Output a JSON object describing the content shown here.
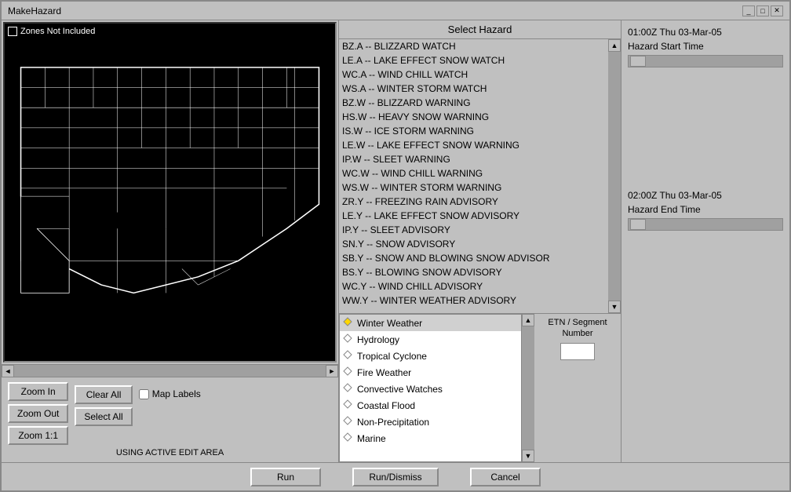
{
  "window": {
    "title": "MakeHazard",
    "controls": [
      "_",
      "□",
      "✕"
    ]
  },
  "map": {
    "zones_label": "Zones Not Included",
    "status": "USING ACTIVE EDIT AREA"
  },
  "buttons": {
    "zoom_in": "Zoom In",
    "zoom_out": "Zoom Out",
    "zoom_1_1": "Zoom 1:1",
    "clear_all": "Clear All",
    "select_all": "Select All",
    "map_labels": "Map Labels",
    "run": "Run",
    "run_dismiss": "Run/Dismiss",
    "cancel": "Cancel"
  },
  "hazard_panel": {
    "title": "Select Hazard",
    "items": [
      "BZ.A -- BLIZZARD WATCH",
      "LE.A -- LAKE EFFECT SNOW WATCH",
      "WC.A -- WIND CHILL WATCH",
      "WS.A -- WINTER STORM WATCH",
      "BZ.W -- BLIZZARD WARNING",
      "HS.W -- HEAVY SNOW WARNING",
      "IS.W -- ICE STORM WARNING",
      "LE.W -- LAKE EFFECT SNOW WARNING",
      "IP.W -- SLEET WARNING",
      "WC.W -- WIND CHILL WARNING",
      "WS.W -- WINTER STORM WARNING",
      "ZR.Y -- FREEZING RAIN ADVISORY",
      "LE.Y -- LAKE EFFECT SNOW ADVISORY",
      "IP.Y -- SLEET ADVISORY",
      "SN.Y -- SNOW ADVISORY",
      "SB.Y -- SNOW AND BLOWING SNOW ADVISOR",
      "BS.Y -- BLOWING SNOW ADVISORY",
      "WC.Y -- WIND CHILL ADVISORY",
      "WW.Y -- WINTER WEATHER ADVISORY"
    ]
  },
  "categories": {
    "items": [
      "Winter Weather",
      "Hydrology",
      "Tropical Cyclone",
      "Fire Weather",
      "Convective Watches",
      "Coastal Flood",
      "Non-Precipitation",
      "Marine"
    ],
    "selected": "Winter Weather"
  },
  "etn": {
    "label": "ETN / Segment Number",
    "value": ""
  },
  "time": {
    "start_value": "01:00Z Thu 03-Mar-05",
    "start_label": "Hazard Start Time",
    "end_value": "02:00Z Thu 03-Mar-05",
    "end_label": "Hazard End Time"
  }
}
